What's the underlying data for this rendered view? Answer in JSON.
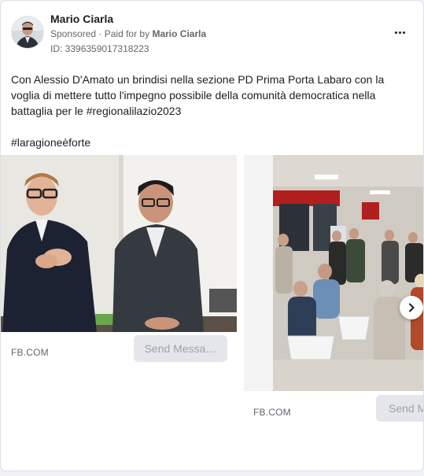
{
  "post": {
    "author": "Mario Ciarla",
    "sponsored": "Sponsored",
    "paid_for_prefix": "Paid for by",
    "paid_for_by": "Mario Ciarla",
    "ad_id": "ID: 3396359017318223",
    "body": "Con Alessio D'Amato un brindisi nella sezione PD Prima Porta Labaro con la voglia di mettere tutto l'impegno possibile della comunità democratica nella battaglia per le #regionalilazio2023",
    "hashtag": "#laragioneèforte"
  },
  "carousel": {
    "cards": [
      {
        "domain": "FB.COM",
        "cta": "Send Messa…"
      },
      {
        "domain": "FB.COM",
        "cta": "Send M"
      }
    ]
  },
  "icons": {
    "more": "more-options-icon",
    "next": "chevron-right-icon"
  }
}
